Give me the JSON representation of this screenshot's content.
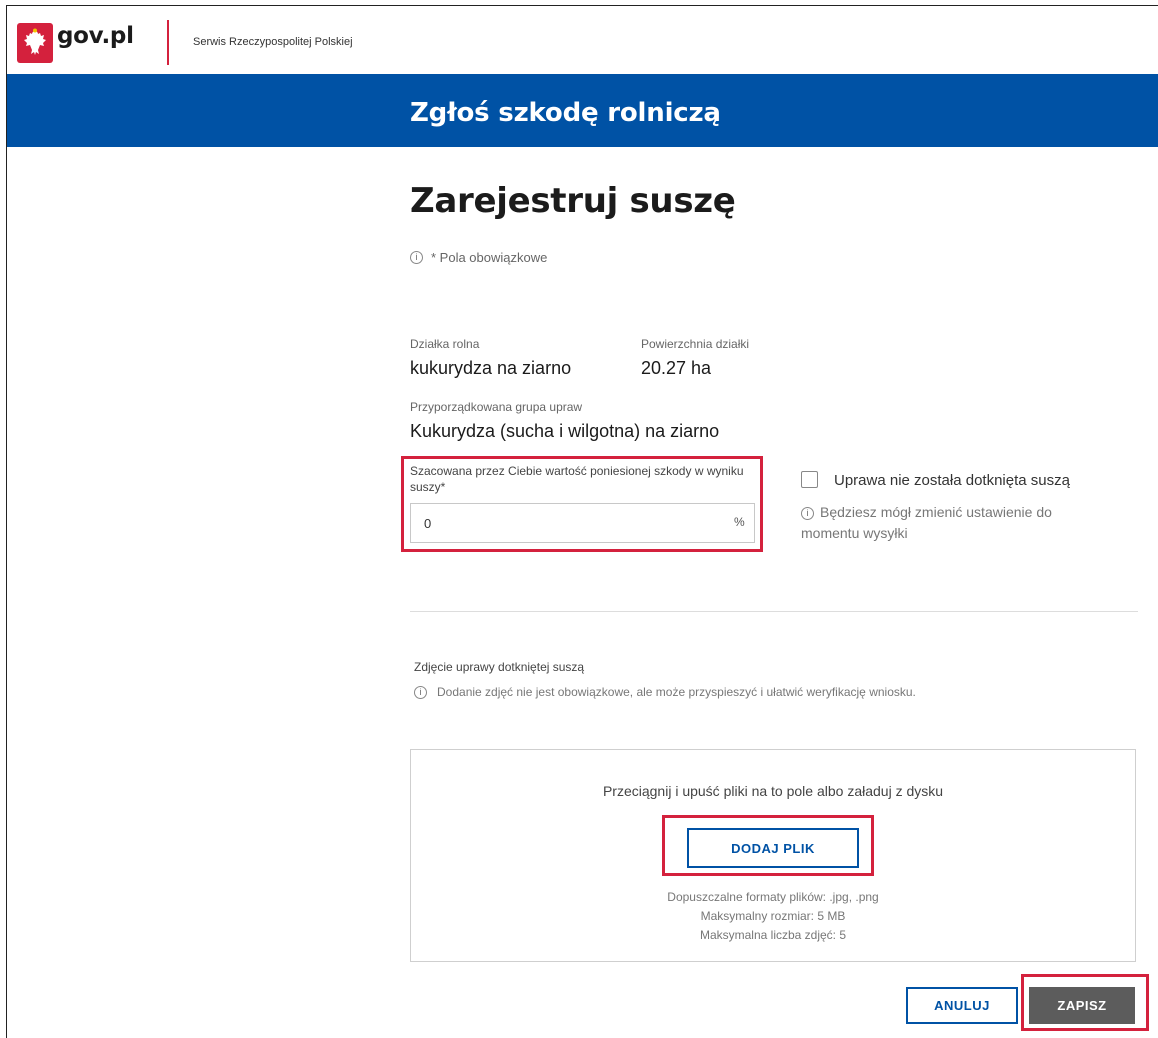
{
  "header": {
    "brand": "gov.pl",
    "service": "Serwis Rzeczypospolitej Polskiej",
    "logo_icon": "eagle-emblem-icon"
  },
  "banner": {
    "title": "Zgłoś szkodę rolniczą"
  },
  "page": {
    "title": "Zarejestruj suszę",
    "required_note": "* Pola obowiązkowe"
  },
  "plot": {
    "plot_label": "Działka rolna",
    "plot_value": "kukurydza na ziarno",
    "area_label": "Powierzchnia działki",
    "area_value": "20.27 ha",
    "group_label": "Przyporządkowana grupa upraw",
    "group_value": "Kukurydza (sucha i wilgotna) na ziarno"
  },
  "damage": {
    "label": "Szacowana przez Ciebie wartość poniesionej szkody w wyniku suszy*",
    "value": "0",
    "unit": "%"
  },
  "not_affected": {
    "label": "Uprawa nie została dotknięta suszą",
    "checked": false,
    "hint": "Będziesz mógł zmienić ustawienie do momentu wysyłki"
  },
  "photos": {
    "label": "Zdjęcie uprawy dotkniętej suszą",
    "hint": "Dodanie zdjęć nie jest obowiązkowe, ale może przyspieszyć i ułatwić weryfikację wniosku.",
    "drop_text": "Przeciągnij i upuść pliki na to pole albo załaduj z dysku",
    "add_button": "DODAJ PLIK",
    "formats": "Dopuszczalne formaty plików: .jpg, .png",
    "max_size": "Maksymalny rozmiar: 5 MB",
    "max_count": "Maksymalna liczba zdjęć: 5"
  },
  "actions": {
    "cancel": "ANULUJ",
    "save": "ZAPISZ"
  },
  "colors": {
    "brand_red": "#d4213d",
    "brand_blue": "#0052a5",
    "save_gray": "#5c5c5c"
  }
}
